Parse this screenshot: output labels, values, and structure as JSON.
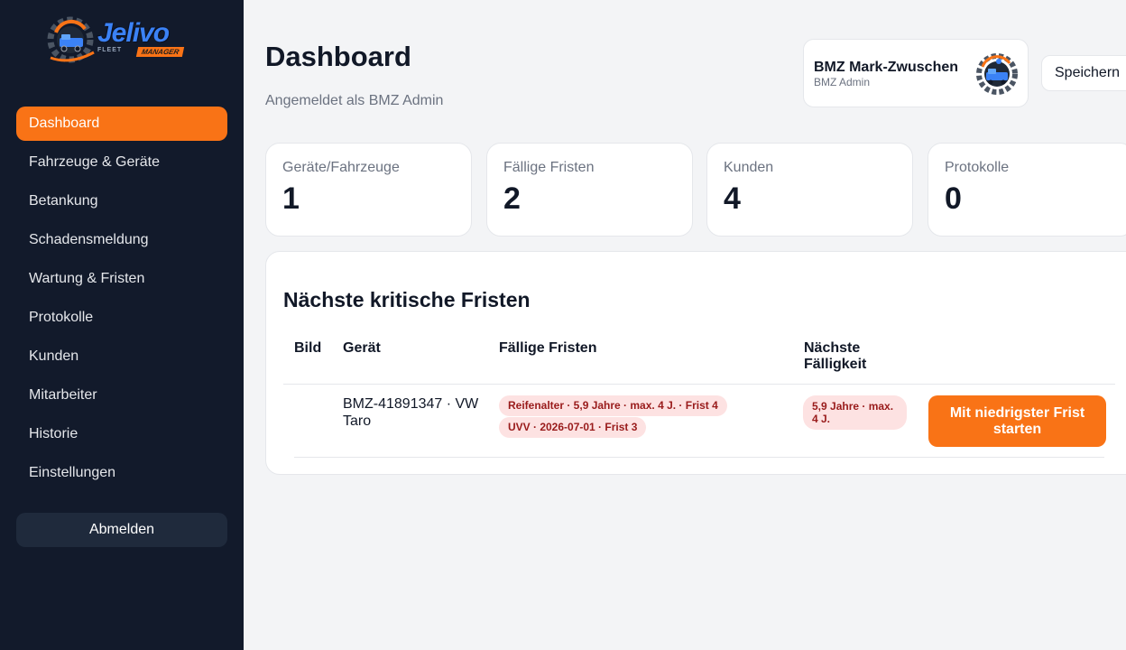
{
  "brand": {
    "logo_text": "Jelivo",
    "logo_sub": "FLEET",
    "logo_badge": "MANAGER"
  },
  "sidebar": {
    "items": [
      {
        "label": "Dashboard",
        "active": true
      },
      {
        "label": "Fahrzeuge & Geräte"
      },
      {
        "label": "Betankung"
      },
      {
        "label": "Schadensmeldung"
      },
      {
        "label": "Wartung & Fristen"
      },
      {
        "label": "Protokolle"
      },
      {
        "label": "Kunden"
      },
      {
        "label": "Mitarbeiter"
      },
      {
        "label": "Historie"
      },
      {
        "label": "Einstellungen"
      }
    ],
    "logout_label": "Abmelden"
  },
  "header": {
    "title": "Dashboard",
    "subtitle": "Angemeldet als BMZ Admin",
    "company_name": "BMZ Mark-Zwuschen",
    "company_role": "BMZ Admin",
    "save_label": "Speichern"
  },
  "stats": [
    {
      "label": "Geräte/Fahrzeuge",
      "value": "1"
    },
    {
      "label": "Fällige Fristen",
      "value": "2"
    },
    {
      "label": "Kunden",
      "value": "4"
    },
    {
      "label": "Protokolle",
      "value": "0"
    }
  ],
  "critical": {
    "title": "Nächste kritische Fristen",
    "columns": [
      "Bild",
      "Gerät",
      "Fällige Fristen",
      "Nächste Fälligkeit"
    ],
    "rows": [
      {
        "image": "",
        "device": "BMZ-41891347 · VW Taro",
        "deadlines": [
          "Reifenalter · 5,9 Jahre · max. 4 J. · Frist 4",
          "UVV · 2026-07-01 · Frist 3"
        ],
        "next_due": "5,9 Jahre · max. 4 J.",
        "action_label": "Mit niedrigster Frist starten"
      }
    ]
  },
  "colors": {
    "sidebar_bg": "#121a2b",
    "accent": "#f97316",
    "tag_bg": "#fde2e2",
    "tag_text": "#991b1b"
  }
}
